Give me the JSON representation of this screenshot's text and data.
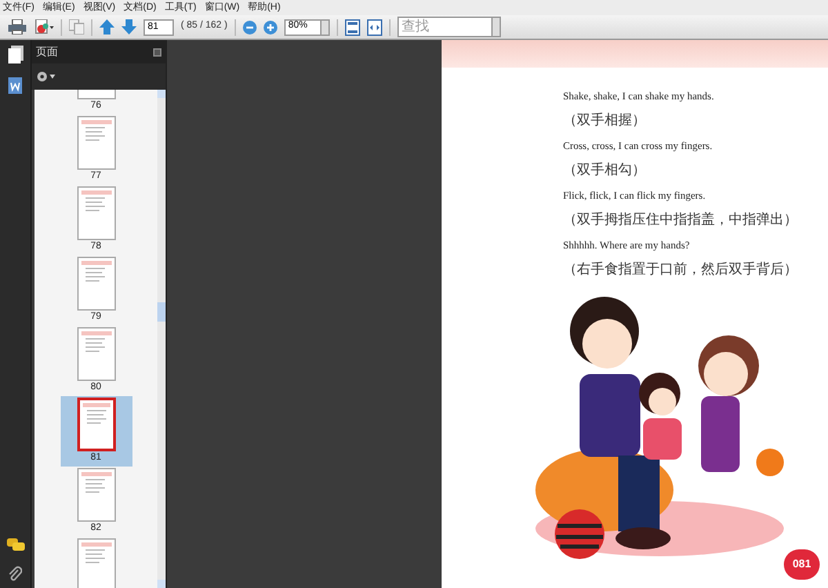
{
  "menu": [
    "文件(F)",
    "编辑(E)",
    "视图(V)",
    "文档(D)",
    "工具(T)",
    "窗口(W)",
    "帮助(H)"
  ],
  "toolbar": {
    "page_number": "81",
    "page_count": "( 85 / 162 )",
    "zoom": "80%",
    "search": {
      "placeholder": "查找"
    }
  },
  "panel": {
    "title": "页面"
  },
  "thumbnails": [
    {
      "label": "76",
      "selected": false
    },
    {
      "label": "77",
      "selected": false
    },
    {
      "label": "78",
      "selected": false
    },
    {
      "label": "79",
      "selected": false
    },
    {
      "label": "80",
      "selected": false
    },
    {
      "label": "81",
      "selected": true
    },
    {
      "label": "82",
      "selected": false
    },
    {
      "selected": false
    }
  ],
  "document": {
    "lines": [
      {
        "kind": "english",
        "text": "Shake, shake, I can shake my hands."
      },
      {
        "kind": "chinese",
        "text": "（双手相握）"
      },
      {
        "kind": "english",
        "text": "Cross, cross, I can cross my fingers."
      },
      {
        "kind": "chinese",
        "text": "（双手相勾）"
      },
      {
        "kind": "english",
        "text": "Flick, flick, I can flick my fingers."
      },
      {
        "kind": "chinese",
        "text": "（双手拇指压住中指指盖，中指弹出）"
      },
      {
        "kind": "english",
        "text": "Shhhhh. Where are my hands?"
      },
      {
        "kind": "chinese",
        "text": "（右手食指置于口前，然后双手背后）"
      }
    ],
    "page_badge": "081"
  }
}
